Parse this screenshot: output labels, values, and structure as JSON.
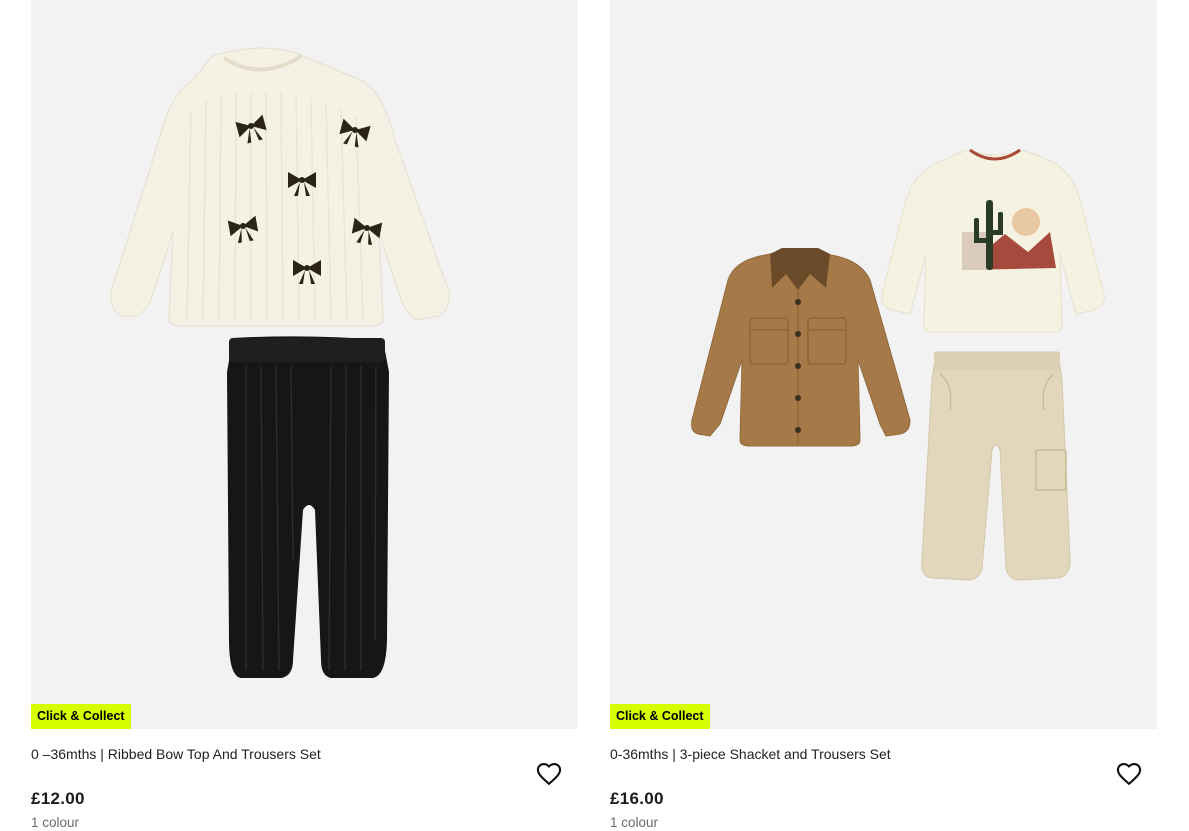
{
  "products": [
    {
      "badge": "Click & Collect",
      "title": "0 –36mths | Ribbed Bow Top And Trousers Set",
      "price": "£12.00",
      "colours": "1 colour",
      "wishlist_icon": "heart-outline-icon",
      "image_description_items": [
        "cream-knit-bow-jumper",
        "black-ribbed-trousers"
      ]
    },
    {
      "badge": "Click & Collect",
      "title": "0-36mths | 3-piece Shacket and Trousers Set",
      "price": "£16.00",
      "colours": "1 colour",
      "wishlist_icon": "heart-outline-icon",
      "image_description_items": [
        "tan-shacket-corduroy-collar",
        "cream-cactus-tshirt",
        "beige-cargo-trousers"
      ]
    }
  ],
  "colors": {
    "badge_bg": "#d7ff00",
    "image_bg": "#f2f2f2",
    "text": "#222222",
    "muted": "#6b6b6b"
  }
}
